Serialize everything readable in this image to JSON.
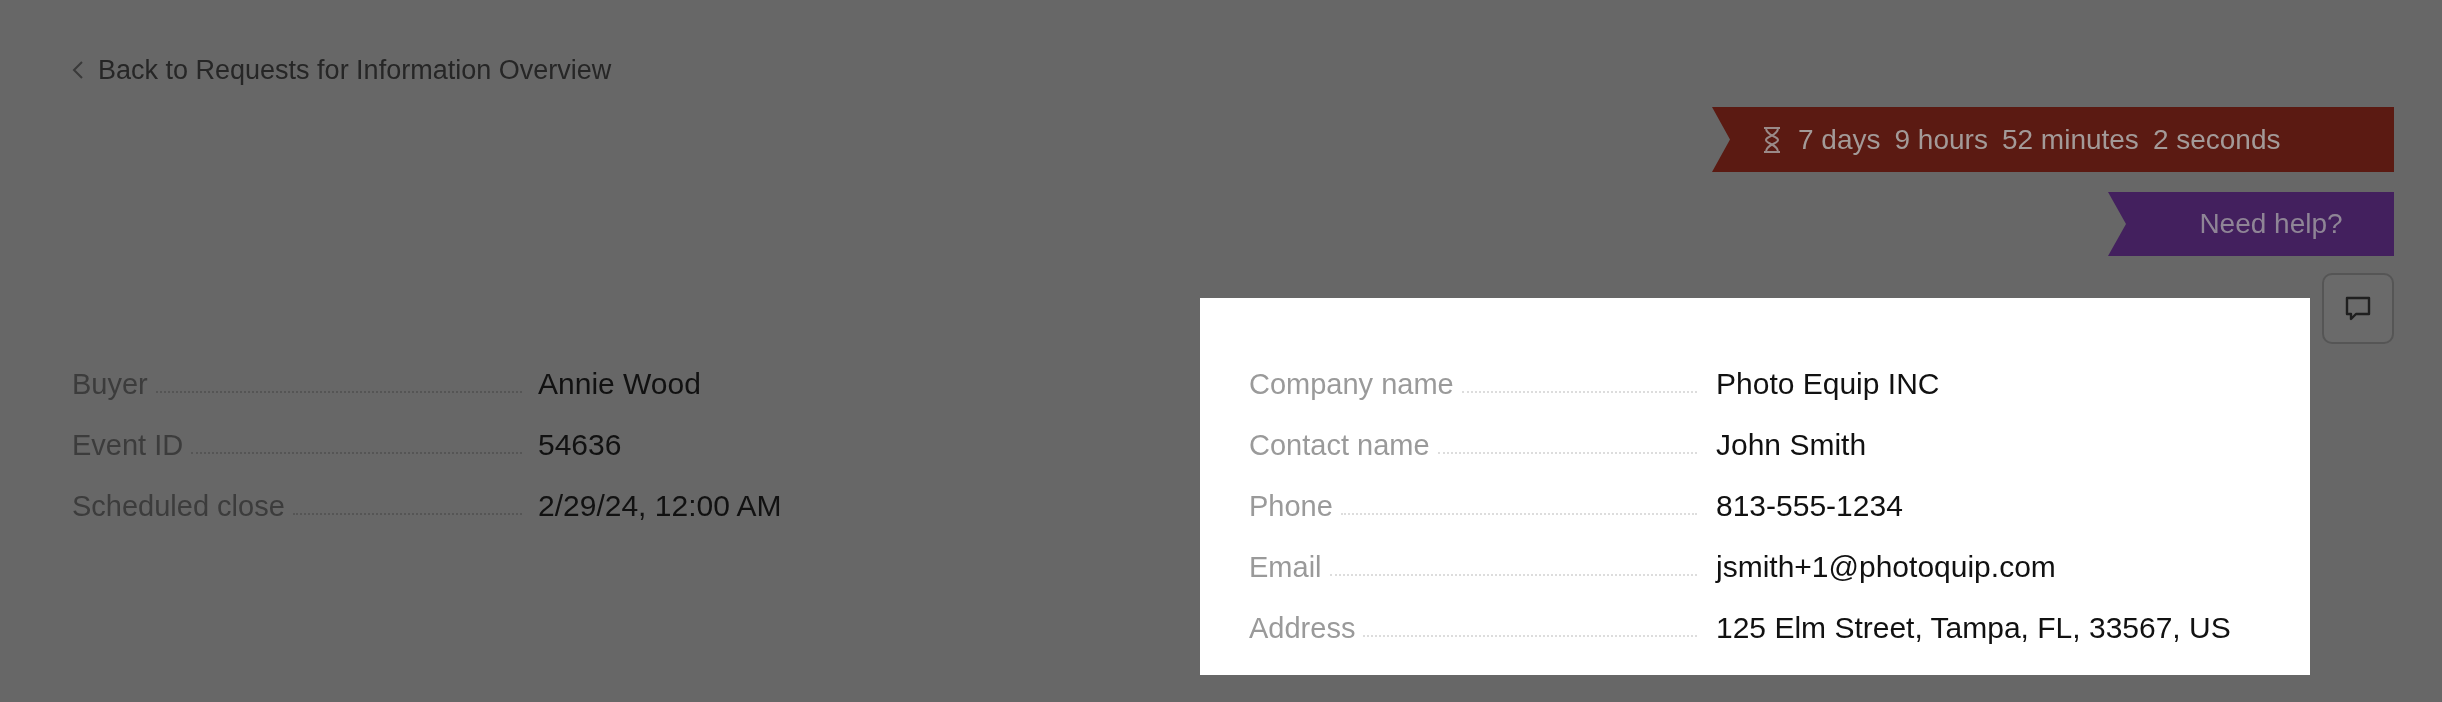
{
  "back_link": {
    "label": "Back to Requests for Information Overview"
  },
  "countdown": {
    "segments": [
      "7 days",
      "9 hours",
      "52 minutes",
      "2 seconds"
    ]
  },
  "help_button": {
    "label": "Need help?"
  },
  "event_details": [
    {
      "label": "Buyer",
      "value": "Annie Wood"
    },
    {
      "label": "Event ID",
      "value": "54636"
    },
    {
      "label": "Scheduled close",
      "value": "2/29/24, 12:00 AM"
    }
  ],
  "supplier_card": [
    {
      "label": "Company name",
      "value": "Photo Equip INC"
    },
    {
      "label": "Contact name",
      "value": "John Smith"
    },
    {
      "label": "Phone",
      "value": "813-555-1234"
    },
    {
      "label": "Email",
      "value": "jsmith+1@photoquip.com"
    },
    {
      "label": "Address",
      "value": "125 Elm Street, Tampa, FL, 33567, US"
    }
  ]
}
